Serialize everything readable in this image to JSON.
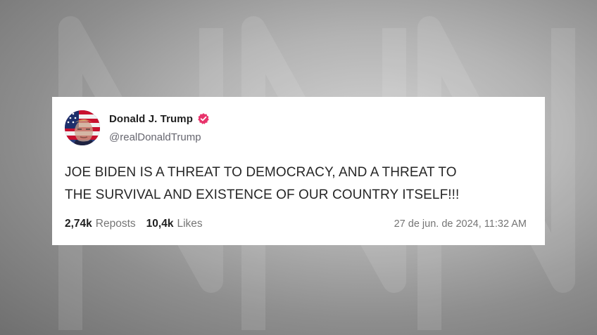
{
  "post": {
    "author": {
      "display_name": "Donald J. Trump",
      "handle": "@realDonaldTrump",
      "verified_icon": "verified-badge-icon",
      "verified_color": "#e8336b"
    },
    "text_lines": [
      "JOE BIDEN IS A THREAT TO DEMOCRACY, AND A THREAT TO",
      "THE SURVIVAL AND EXISTENCE OF OUR COUNTRY ITSELF!!!"
    ],
    "stats": {
      "reposts_count": "2,74k",
      "reposts_label": "Reposts",
      "likes_count": "10,4k",
      "likes_label": "Likes"
    },
    "timestamp": "27 de jun. de 2024, 11:32 AM"
  },
  "colors": {
    "card_background": "#ffffff",
    "text": "#262626",
    "muted": "#757575"
  }
}
